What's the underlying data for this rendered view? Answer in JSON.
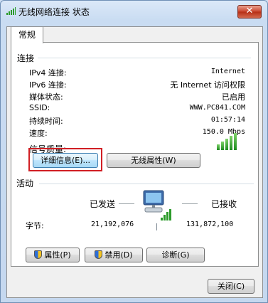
{
  "window": {
    "title": "无线网络连接 状态",
    "close_glyph": "✕"
  },
  "tabs": [
    {
      "label": "常规"
    }
  ],
  "connection": {
    "group_label": "连接",
    "rows": [
      {
        "label": "IPv4 连接:",
        "value": "Internet"
      },
      {
        "label": "IPv6 连接:",
        "value": "无 Internet 访问权限"
      },
      {
        "label": "媒体状态:",
        "value": "已启用"
      },
      {
        "label": "SSID:",
        "value": "WWW.PC841.COM"
      },
      {
        "label": "持续时间:",
        "value": "01:57:14"
      },
      {
        "label": "速度:",
        "value": "150.0 Mbps"
      }
    ],
    "signal_label": "信号质量:",
    "signal_bars_lit": 5,
    "signal_bars_total": 5,
    "details_button": "详细信息(E)...",
    "wireless_props_button": "无线属性(W)"
  },
  "activity": {
    "group_label": "活动",
    "sent_label": "已发送",
    "received_label": "已接收",
    "bytes_label": "字节:",
    "bytes_sent": "21,192,076",
    "bytes_received": "131,872,100"
  },
  "actions": {
    "properties_button": "属性(P)",
    "disable_button": "禁用(D)",
    "diagnose_button": "诊断(G)"
  },
  "footer": {
    "close_button": "关闭(C)"
  },
  "colors": {
    "signal_green": "#2c9b2b",
    "highlight_red": "#d11f24"
  }
}
